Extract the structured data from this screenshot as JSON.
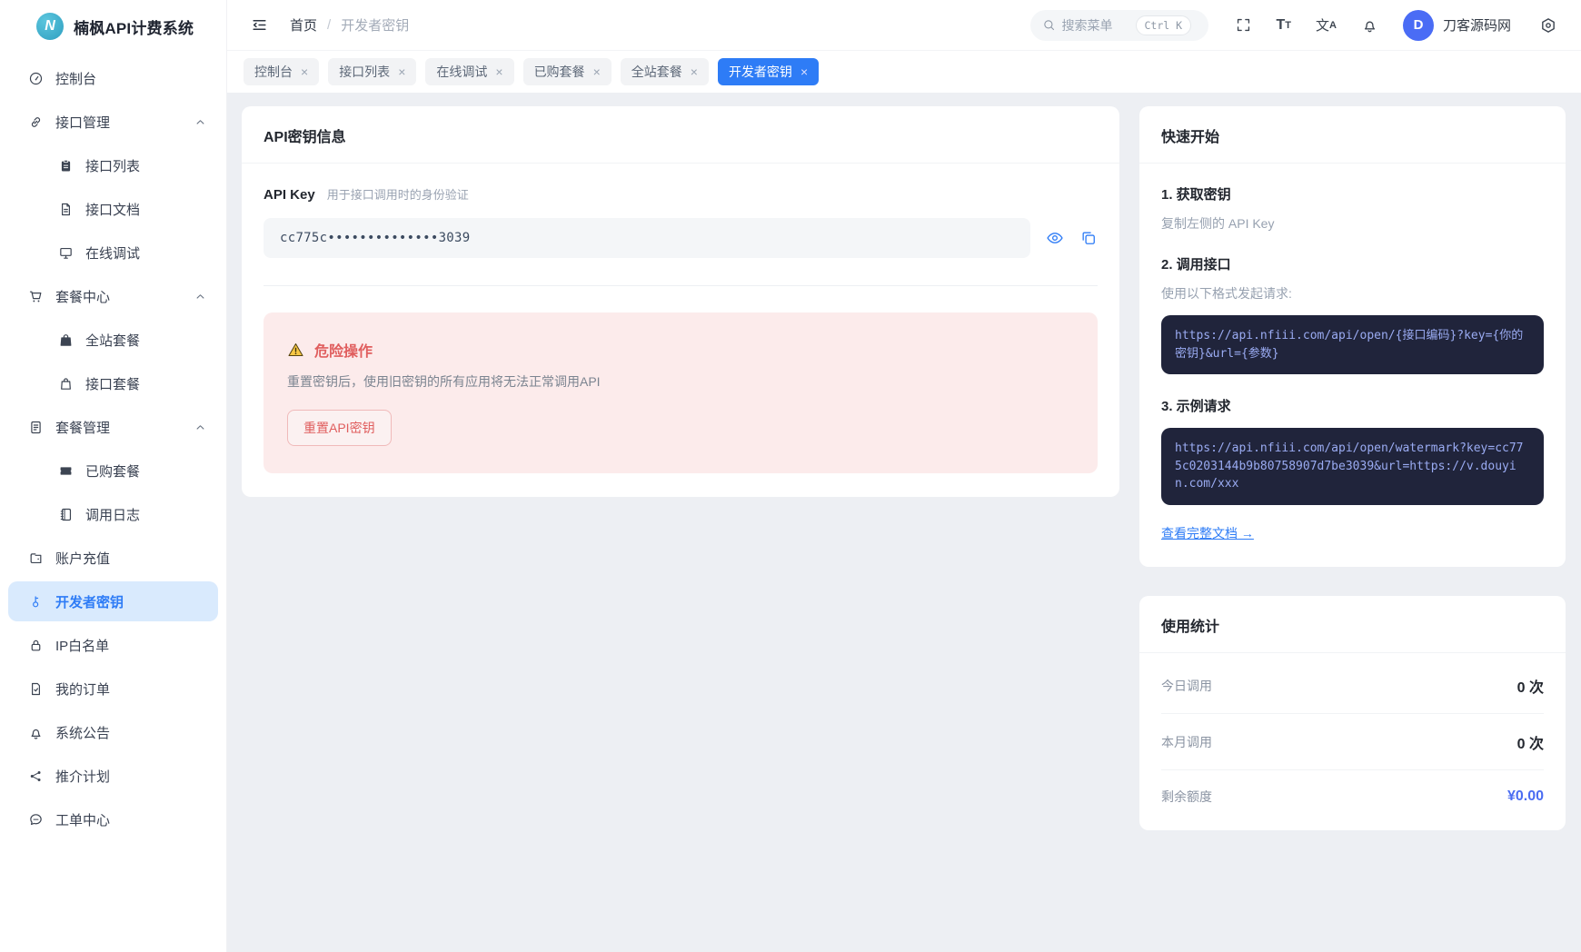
{
  "app": {
    "name": "楠枫API计费系统",
    "logo_letter": "N"
  },
  "header": {
    "breadcrumb": {
      "home": "首页",
      "separator": "/",
      "current": "开发者密钥"
    },
    "search": {
      "placeholder": "搜索菜单",
      "shortcut": "Ctrl K"
    },
    "text_size_icon": {
      "large": "T",
      "small": "T"
    },
    "translate_icon": {
      "cn": "文",
      "en": "A"
    },
    "user": {
      "name": "刀客源码网",
      "avatar_letter": "D"
    }
  },
  "tabbar": {
    "close_glyph": "×",
    "tabs": [
      {
        "label": "控制台"
      },
      {
        "label": "接口列表"
      },
      {
        "label": "在线调试"
      },
      {
        "label": "已购套餐"
      },
      {
        "label": "全站套餐"
      },
      {
        "label": "开发者密钥",
        "active": true
      }
    ]
  },
  "sidebar": {
    "items": [
      {
        "label": "控制台",
        "icon": "gauge-icon"
      },
      {
        "label": "接口管理",
        "icon": "link-icon",
        "expandable": true
      },
      {
        "label": "接口列表",
        "icon": "clipboard-icon",
        "sub": true
      },
      {
        "label": "接口文档",
        "icon": "document-icon",
        "sub": true
      },
      {
        "label": "在线调试",
        "icon": "monitor-icon",
        "sub": true
      },
      {
        "label": "套餐中心",
        "icon": "cart-icon",
        "expandable": true
      },
      {
        "label": "全站套餐",
        "icon": "bag-filled-icon",
        "sub": true
      },
      {
        "label": "接口套餐",
        "icon": "bag-outline-icon",
        "sub": true
      },
      {
        "label": "套餐管理",
        "icon": "list-icon",
        "expandable": true
      },
      {
        "label": "已购套餐",
        "icon": "ticket-icon",
        "sub": true
      },
      {
        "label": "调用日志",
        "icon": "log-icon",
        "sub": true
      },
      {
        "label": "账户充值",
        "icon": "wallet-icon"
      },
      {
        "label": "开发者密钥",
        "icon": "key-icon",
        "active": true
      },
      {
        "label": "IP白名单",
        "icon": "lock-icon"
      },
      {
        "label": "我的订单",
        "icon": "order-icon"
      },
      {
        "label": "系统公告",
        "icon": "bell-icon"
      },
      {
        "label": "推介计划",
        "icon": "share-icon"
      },
      {
        "label": "工单中心",
        "icon": "chat-icon"
      }
    ]
  },
  "api_card": {
    "title": "API密钥信息",
    "key_label": "API Key",
    "key_hint": "用于接口调用时的身份验证",
    "masked_key": "cc775c••••••••••••••3039",
    "danger": {
      "title": "危险操作",
      "description": "重置密钥后，使用旧密钥的所有应用将无法正常调用API",
      "reset_button": "重置API密钥"
    }
  },
  "quick_start": {
    "title": "快速开始",
    "step1": {
      "title": "1. 获取密钥",
      "description": "复制左侧的 API Key"
    },
    "step2": {
      "title": "2. 调用接口",
      "description": "使用以下格式发起请求:",
      "code": "https://api.nfiii.com/api/open/{接口编码}?key={你的密钥}&url={参数}"
    },
    "step3": {
      "title": "3. 示例请求",
      "code": "https://api.nfiii.com/api/open/watermark?key=cc775c0203144b9b80758907d7be3039&url=https://v.douyin.com/xxx"
    },
    "doc_link": "查看完整文档 →"
  },
  "usage": {
    "title": "使用统计",
    "rows": [
      {
        "label": "今日调用",
        "value": "0 次"
      },
      {
        "label": "本月调用",
        "value": "0 次"
      },
      {
        "label": "剩余额度",
        "value": "¥0.00"
      }
    ]
  },
  "colors": {
    "accent_blue": "#2e7cf6",
    "active_item_bg": "#d9eafd",
    "avatar_indigo": "#4a6cf5",
    "balance_blue": "#4b6df2",
    "danger_red": "#e05e5e",
    "danger_bg": "#fcebeb",
    "code_bg": "#20243b",
    "code_text": "#9aabf2",
    "logo_teal": "#3fb0cc"
  }
}
